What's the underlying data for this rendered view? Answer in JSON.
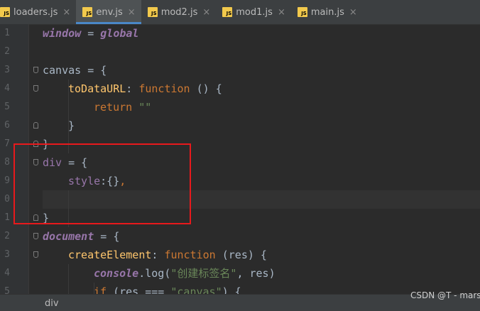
{
  "tabs": [
    {
      "label": "loaders.js",
      "icon": "js-file-icon",
      "active": false
    },
    {
      "label": "env.js",
      "icon": "js-file-icon",
      "active": true
    },
    {
      "label": "mod2.js",
      "icon": "js-file-icon",
      "active": false
    },
    {
      "label": "mod1.js",
      "icon": "js-file-icon",
      "active": false
    },
    {
      "label": "main.js",
      "icon": "js-file-icon",
      "active": false
    }
  ],
  "icon_badge": "JS",
  "close_glyph": "×",
  "line_numbers": [
    "1",
    "2",
    "3",
    "4",
    "5",
    "6",
    "7",
    "8",
    "9",
    "0",
    "1",
    "2",
    "3",
    "4",
    "5"
  ],
  "code": {
    "l1": {
      "t1": "window",
      "t2": " = ",
      "t3": "global"
    },
    "l3": {
      "t1": "canvas",
      "t2": " = {"
    },
    "l4": {
      "t1": "toDataURL",
      "t2": ": ",
      "t3": "function",
      "t4": " () {"
    },
    "l5": {
      "t1": "return",
      "t2": " ",
      "t3": "\"\""
    },
    "l6": {
      "t1": "}"
    },
    "l7": {
      "t1": "}"
    },
    "l8": {
      "t1": "div",
      "t2": " = {"
    },
    "l9": {
      "t1": "style",
      "t2": ":{}",
      "t3": ","
    },
    "l11": {
      "t1": "}"
    },
    "l12": {
      "t1": "document",
      "t2": " = {"
    },
    "l13": {
      "t1": "createElement",
      "t2": ": ",
      "t3": "function",
      "t4": " (res) {"
    },
    "l14": {
      "t1": "console",
      "t2": ".",
      "t3": "log",
      "t4": "(",
      "t5": "\"创建标签名\"",
      "t6": ", res)"
    },
    "l15": {
      "t1": "if",
      "t2": " (res === ",
      "t3": "\"canvas\"",
      "t4": ") {"
    }
  },
  "breadcrumb": "div",
  "watermark": "CSDN @T - mars",
  "colors": {
    "highlight_box": "#e8191c",
    "keyword": "#cc7832",
    "string": "#6a8759",
    "function_name": "#ffc66d"
  }
}
